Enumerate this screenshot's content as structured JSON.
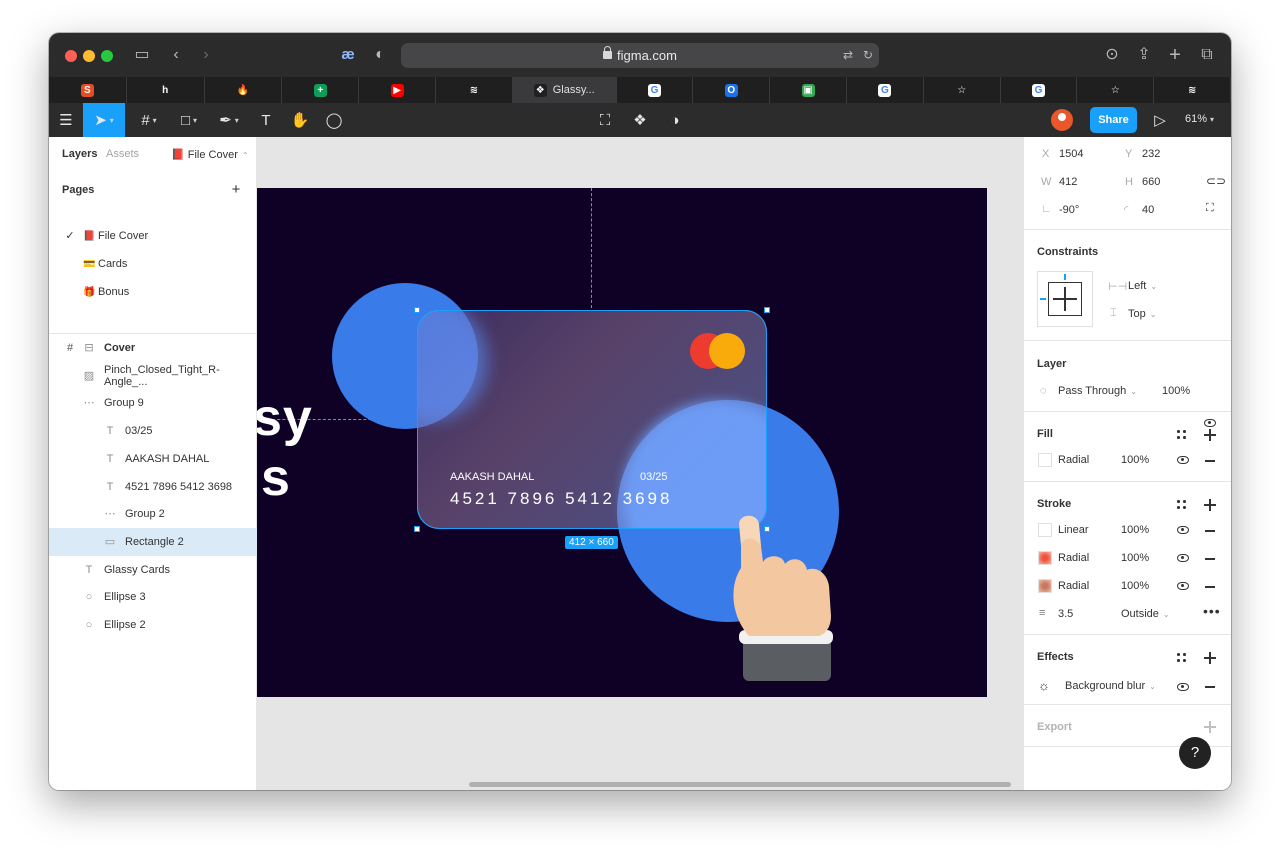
{
  "browser": {
    "url": "figma.com",
    "tabs": [
      {
        "icon": "S",
        "color": "#e44d26",
        "label": ""
      },
      {
        "icon": "h",
        "color": "#1f1f20",
        "label": ""
      },
      {
        "icon": "🔥",
        "color": "#1f1f20",
        "label": ""
      },
      {
        "icon": "+",
        "color": "#0f9d58",
        "label": ""
      },
      {
        "icon": "▶",
        "color": "#ff0000",
        "label": ""
      },
      {
        "icon": "≋",
        "color": "#1f1f20",
        "label": ""
      },
      {
        "icon": "❖",
        "color": "#1f1f20",
        "label": "Glassy..."
      },
      {
        "icon": "G",
        "color": "#ffffff",
        "label": ""
      },
      {
        "icon": "O",
        "color": "#1a73e8",
        "label": ""
      },
      {
        "icon": "▣",
        "color": "#34a853",
        "label": ""
      },
      {
        "icon": "G",
        "color": "#ffffff",
        "label": ""
      },
      {
        "icon": "☆",
        "color": "#1f1f20",
        "label": ""
      },
      {
        "icon": "G",
        "color": "#ffffff",
        "label": ""
      },
      {
        "icon": "☆",
        "color": "#1f1f20",
        "label": ""
      },
      {
        "icon": "≋",
        "color": "#1f1f20",
        "label": ""
      }
    ]
  },
  "toolbar": {
    "share_label": "Share",
    "zoom_label": "61%"
  },
  "left_panel": {
    "tab_layers": "Layers",
    "tab_assets": "Assets",
    "current_page": "File Cover",
    "pages_title": "Pages",
    "pages": [
      {
        "emoji": "📕",
        "name": "File Cover",
        "selected": true
      },
      {
        "emoji": "💳",
        "name": "Cards",
        "selected": false
      },
      {
        "emoji": "🎁",
        "name": "Bonus",
        "selected": false
      }
    ],
    "layers": [
      {
        "name": "Cover",
        "icon": "frame",
        "indent": 0,
        "bold": true
      },
      {
        "name": "Pinch_Closed_Tight_R-Angle_...",
        "icon": "image",
        "indent": 1
      },
      {
        "name": "Group 9",
        "icon": "group",
        "indent": 1
      },
      {
        "name": "03/25",
        "icon": "text",
        "indent": 2
      },
      {
        "name": "AAKASH DAHAL",
        "icon": "text",
        "indent": 2
      },
      {
        "name": "4521 7896 5412 3698",
        "icon": "text",
        "indent": 2
      },
      {
        "name": "Group 2",
        "icon": "group",
        "indent": 2
      },
      {
        "name": "Rectangle 2",
        "icon": "rect",
        "indent": 2,
        "selected": true
      },
      {
        "name": "Glassy Cards",
        "icon": "text",
        "indent": 1
      },
      {
        "name": "Ellipse 3",
        "icon": "ellipse",
        "indent": 1
      },
      {
        "name": "Ellipse 2",
        "icon": "ellipse",
        "indent": 1
      }
    ]
  },
  "canvas": {
    "title_fragment_1": "sy",
    "title_fragment_2": "s",
    "card_name": "AAKASH DAHAL",
    "card_expiry": "03/25",
    "card_number": "4521 7896 5412 3698",
    "dimension_tag": "412 × 660"
  },
  "right_panel": {
    "x_label": "X",
    "x_value": "1504",
    "y_label": "Y",
    "y_value": "232",
    "w_label": "W",
    "w_value": "412",
    "h_label": "H",
    "h_value": "660",
    "rotation_value": "-90°",
    "radius_value": "40",
    "constraints_title": "Constraints",
    "constraint_h": "Left",
    "constraint_v": "Top",
    "layer_title": "Layer",
    "blend_mode": "Pass Through",
    "layer_opacity": "100%",
    "fill_title": "Fill",
    "fills": [
      {
        "type": "Radial",
        "opacity": "100%",
        "color": "#ffffff"
      }
    ],
    "stroke_title": "Stroke",
    "strokes": [
      {
        "type": "Linear",
        "opacity": "100%",
        "color": "#ffffff"
      },
      {
        "type": "Radial",
        "opacity": "100%",
        "color": "#f0533c"
      },
      {
        "type": "Radial",
        "opacity": "100%",
        "color": "#c77a62"
      }
    ],
    "stroke_weight": "3.5",
    "stroke_position": "Outside",
    "effects_title": "Effects",
    "effect_name": "Background blur",
    "export_title": "Export",
    "help_label": "?"
  }
}
